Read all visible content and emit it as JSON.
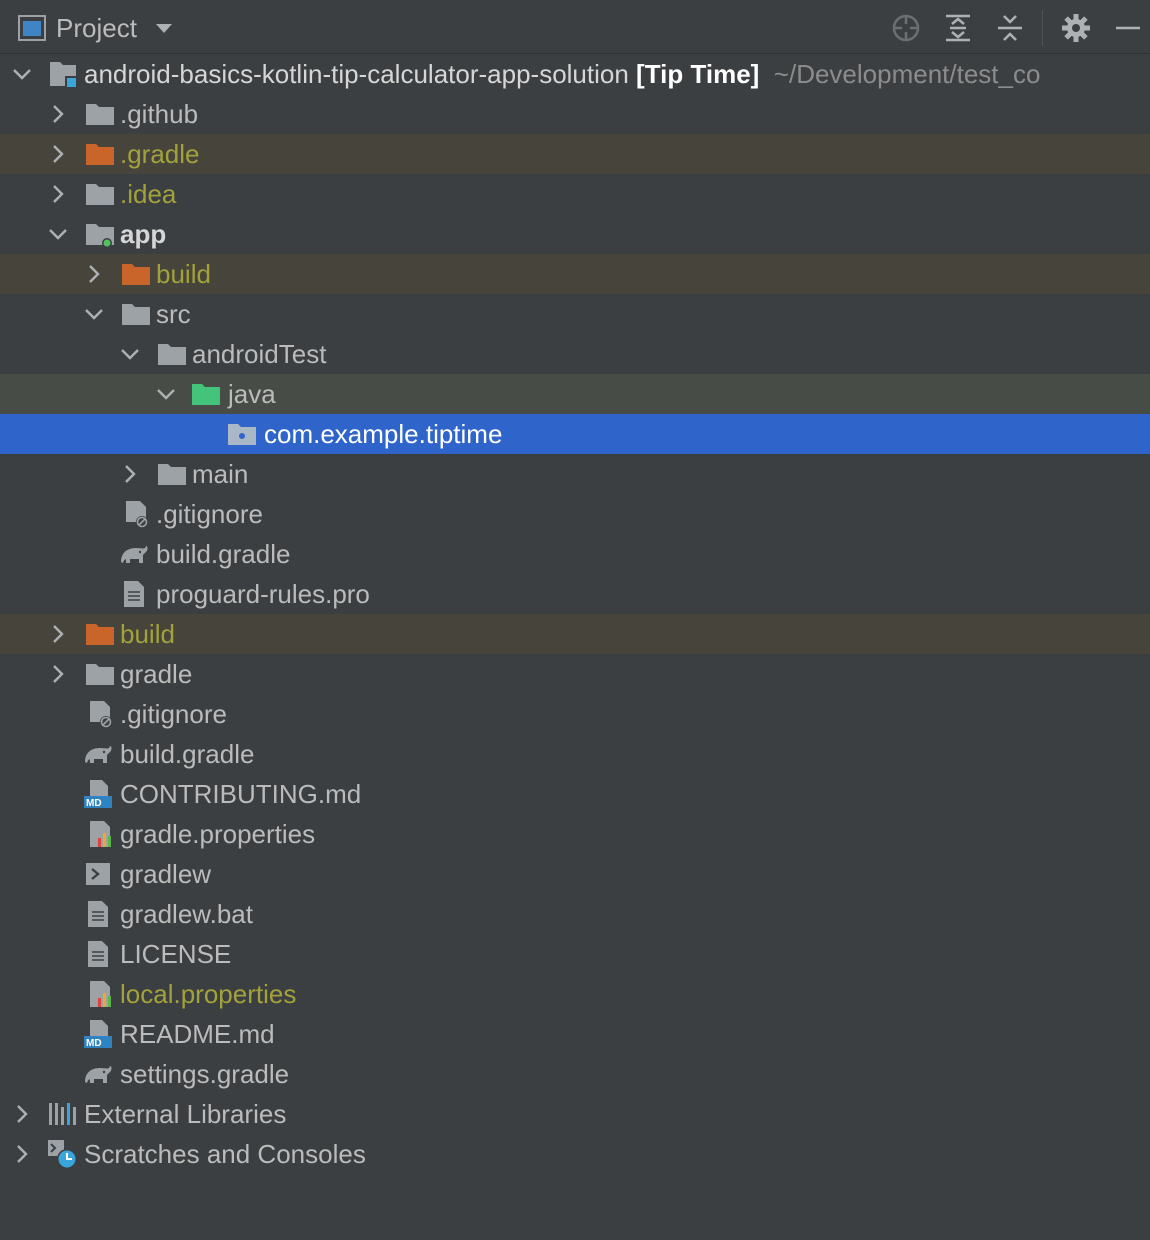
{
  "toolbar": {
    "title": "Project",
    "icons": [
      "project-view-icon",
      "chevron-down-icon",
      "locate-icon",
      "expand-all-icon",
      "collapse-all-icon",
      "gear-icon",
      "minimize-icon"
    ]
  },
  "tree": {
    "root": {
      "name": "android-basics-kotlin-tip-calculator-app-solution",
      "module": "[Tip Time]",
      "path": "~/Development/test_co"
    },
    "items": [
      {
        "label": ".github"
      },
      {
        "label": ".gradle"
      },
      {
        "label": ".idea"
      },
      {
        "label": "app"
      },
      {
        "label": "build"
      },
      {
        "label": "src"
      },
      {
        "label": "androidTest"
      },
      {
        "label": "java"
      },
      {
        "label": "com.example.tiptime"
      },
      {
        "label": "main"
      },
      {
        "label": ".gitignore"
      },
      {
        "label": "build.gradle"
      },
      {
        "label": "proguard-rules.pro"
      },
      {
        "label": "build"
      },
      {
        "label": "gradle"
      },
      {
        "label": ".gitignore"
      },
      {
        "label": "build.gradle"
      },
      {
        "label": "CONTRIBUTING.md"
      },
      {
        "label": "gradle.properties"
      },
      {
        "label": "gradlew"
      },
      {
        "label": "gradlew.bat"
      },
      {
        "label": "LICENSE"
      },
      {
        "label": "local.properties"
      },
      {
        "label": "README.md"
      },
      {
        "label": "settings.gradle"
      },
      {
        "label": "External Libraries"
      },
      {
        "label": "Scratches and Consoles"
      }
    ]
  },
  "colors": {
    "background": "#3c3f41",
    "selection": "#2f65ca",
    "ignored_row": "#47443b",
    "source_root_row": "#474c46",
    "ignored_text": "#a2a23c",
    "excluded_folder": "#c9652b",
    "source_folder": "#44c37a",
    "folder": "#9da2a6"
  }
}
